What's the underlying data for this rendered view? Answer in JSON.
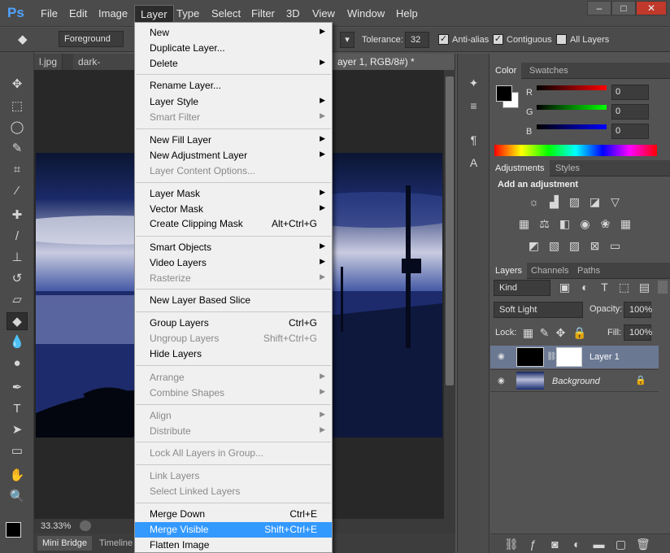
{
  "app": {
    "logo": "Ps"
  },
  "menubar": [
    "File",
    "Edit",
    "Image",
    "Layer",
    "Type",
    "Select",
    "Filter",
    "3D",
    "View",
    "Window",
    "Help"
  ],
  "window_controls": {
    "minimize": "–",
    "maximize": "□",
    "close": "✕"
  },
  "options": {
    "foreground_select": "Foreground",
    "tolerance_label": "Tolerance:",
    "tolerance_value": "32",
    "antialias": "Anti-alias",
    "contiguous": "Contiguous",
    "all_layers": "All Layers"
  },
  "doc_tabs": [
    {
      "label": "l.jpg"
    },
    {
      "label": "dark-summer"
    },
    {
      "label": "ayer 1, RGB/8#) *"
    }
  ],
  "status": {
    "zoom": "33.33%"
  },
  "bottom_tabs": {
    "mini_bridge": "Mini Bridge",
    "timeline": "Timeline"
  },
  "color_panel": {
    "tabs": [
      "Color",
      "Swatches"
    ],
    "r_label": "R",
    "g_label": "G",
    "b_label": "B",
    "r": "0",
    "g": "0",
    "b": "0"
  },
  "adjustments_panel": {
    "tabs": [
      "Adjustments",
      "Styles"
    ],
    "title": "Add an adjustment"
  },
  "layers_panel": {
    "tabs": [
      "Layers",
      "Channels",
      "Paths"
    ],
    "kind": "Kind",
    "blend_mode": "Soft Light",
    "opacity_label": "Opacity:",
    "opacity": "100%",
    "lock_label": "Lock:",
    "fill_label": "Fill:",
    "fill": "100%",
    "layers": [
      {
        "name": "Layer 1"
      },
      {
        "name": "Background"
      }
    ]
  },
  "layer_menu": {
    "items": [
      {
        "label": "New",
        "submenu": true
      },
      {
        "label": "Duplicate Layer..."
      },
      {
        "label": "Delete",
        "submenu": true
      },
      {
        "label": "Rename Layer..."
      },
      {
        "label": "Layer Style",
        "submenu": true
      },
      {
        "label": "Smart Filter",
        "submenu": true,
        "disabled": true
      },
      {
        "label": "New Fill Layer",
        "submenu": true
      },
      {
        "label": "New Adjustment Layer",
        "submenu": true
      },
      {
        "label": "Layer Content Options...",
        "disabled": true
      },
      {
        "label": "Layer Mask",
        "submenu": true
      },
      {
        "label": "Vector Mask",
        "submenu": true
      },
      {
        "label": "Create Clipping Mask",
        "shortcut": "Alt+Ctrl+G"
      },
      {
        "label": "Smart Objects",
        "submenu": true
      },
      {
        "label": "Video Layers",
        "submenu": true
      },
      {
        "label": "Rasterize",
        "submenu": true,
        "disabled": true
      },
      {
        "label": "New Layer Based Slice"
      },
      {
        "label": "Group Layers",
        "shortcut": "Ctrl+G"
      },
      {
        "label": "Ungroup Layers",
        "shortcut": "Shift+Ctrl+G",
        "disabled": true
      },
      {
        "label": "Hide Layers"
      },
      {
        "label": "Arrange",
        "submenu": true,
        "disabled": true
      },
      {
        "label": "Combine Shapes",
        "submenu": true,
        "disabled": true
      },
      {
        "label": "Align",
        "submenu": true,
        "disabled": true
      },
      {
        "label": "Distribute",
        "submenu": true,
        "disabled": true
      },
      {
        "label": "Lock All Layers in Group...",
        "disabled": true
      },
      {
        "label": "Link Layers",
        "disabled": true
      },
      {
        "label": "Select Linked Layers",
        "disabled": true
      },
      {
        "label": "Merge Down",
        "shortcut": "Ctrl+E"
      },
      {
        "label": "Merge Visible",
        "shortcut": "Shift+Ctrl+E",
        "highlighted": true
      },
      {
        "label": "Flatten Image"
      }
    ]
  }
}
